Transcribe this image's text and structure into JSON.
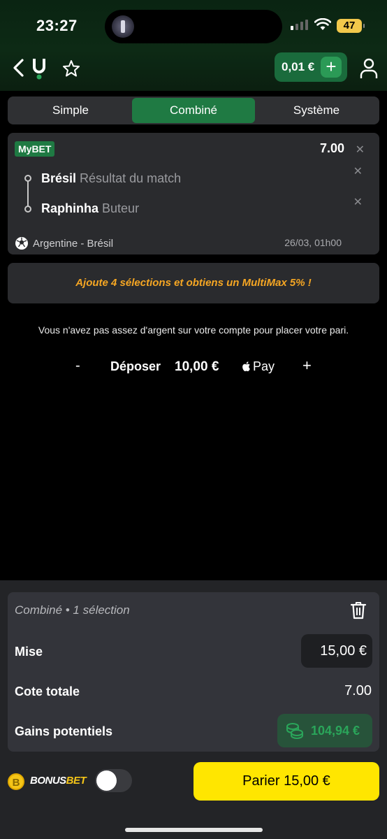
{
  "status_bar": {
    "time": "23:27",
    "battery": "47"
  },
  "header": {
    "balance": "0,01 €",
    "add_symbol": "+"
  },
  "tabs": [
    {
      "label": "Simple",
      "active": false
    },
    {
      "label": "Combiné",
      "active": true
    },
    {
      "label": "Système",
      "active": false
    }
  ],
  "bet_card": {
    "badge": "MyBET",
    "odds": "7.00",
    "selections": [
      {
        "name": "Brésil",
        "market": "Résultat du match"
      },
      {
        "name": "Raphinha",
        "market": "Buteur"
      }
    ],
    "match": "Argentine - Brésil",
    "date": "26/03, 01h00"
  },
  "promo": "Ajoute 4 sélections et obtiens un MultiMax 5% !",
  "warning": "Vous n'avez pas assez d'argent sur votre compte pour placer votre pari.",
  "deposit": {
    "minus": "-",
    "label": "Déposer",
    "amount": "10,00 €",
    "pay_label": "Pay",
    "plus": "+"
  },
  "slip": {
    "header": "Combiné • 1 sélection",
    "stake_label": "Mise",
    "stake_value": "15,00 €",
    "odds_label": "Cote totale",
    "odds_value": "7.00",
    "gains_label": "Gains potentiels",
    "gains_value": "104,94 €"
  },
  "bonus": {
    "coin": "B",
    "label_part1": "BONUS",
    "label_part2": "BET",
    "toggle_on": false
  },
  "bet_button": "Parier 15,00 €",
  "colors": {
    "brand_green": "#1f7a43",
    "accent_yellow": "#ffe600",
    "promo_orange": "#f5a623",
    "gains_green": "#2aa55a"
  }
}
